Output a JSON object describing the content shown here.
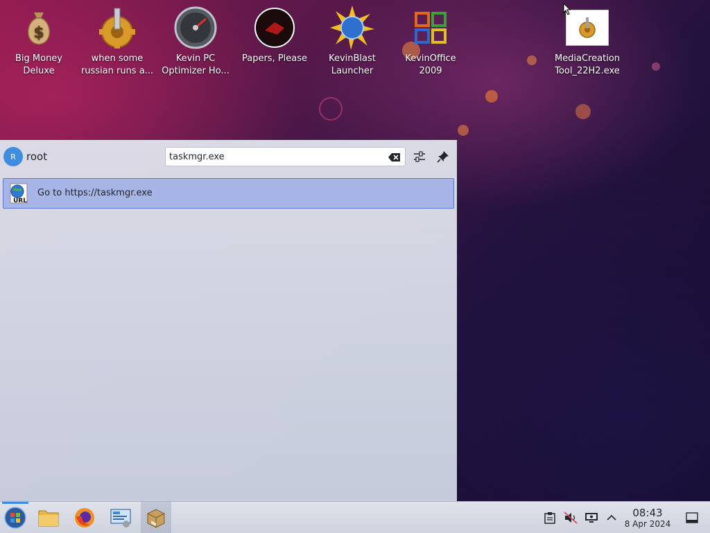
{
  "desktop": {
    "icons": [
      {
        "label": "Big Money Deluxe",
        "icon": "money-bag-icon"
      },
      {
        "label": "when some russian runs a...",
        "icon": "gear-icon"
      },
      {
        "label": "Kevin PC Optimizer Ho...",
        "icon": "speedometer-icon"
      },
      {
        "label": "Papers, Please",
        "icon": "papers-please-icon"
      },
      {
        "label": "KevinBlast Launcher",
        "icon": "globe-burst-icon"
      },
      {
        "label": "KevinOffice 2009",
        "icon": "office-logo-icon"
      },
      {
        "label": "MediaCreation Tool_22H2.exe",
        "icon": "installer-gear-icon"
      }
    ]
  },
  "launcher": {
    "user": {
      "initial": "R",
      "name": "root"
    },
    "search": {
      "value": "taskmgr.exe"
    },
    "results": [
      {
        "label": "Go to https://taskmgr.exe",
        "icon": "url-globe-icon"
      }
    ]
  },
  "taskbar": {
    "items": [
      "start-orb-icon",
      "file-manager-icon",
      "firefox-icon",
      "control-panel-icon",
      "package-icon"
    ],
    "tray": [
      "clipboard-icon",
      "volume-muted-icon",
      "display-icon",
      "chevron-up-icon"
    ],
    "clock": {
      "time": "08:43",
      "date": "8 Apr 2024"
    }
  },
  "colors": {
    "accent": "#3d8ee0",
    "selection": "#96aae6",
    "taskbar": "#d8dbe4"
  }
}
